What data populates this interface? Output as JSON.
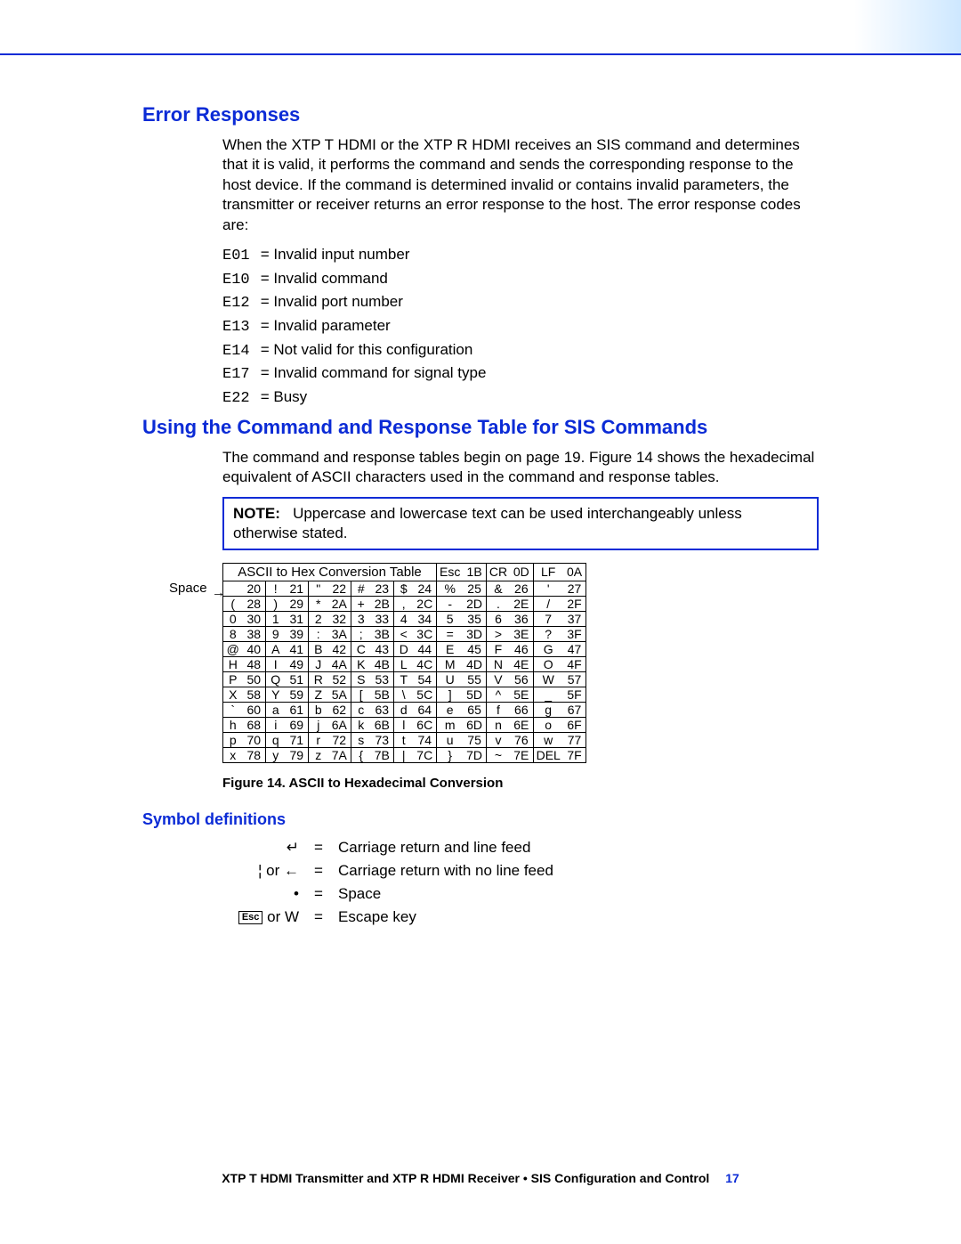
{
  "headings": {
    "error_responses": "Error Responses",
    "using_table": "Using the Command and Response Table for SIS Commands",
    "symbol_defs": "Symbol definitions"
  },
  "paragraphs": {
    "error_intro": "When the XTP T HDMI or the XTP R HDMI receives an SIS command and determines that it is valid, it performs the command and sends the corresponding response to the host device. If the command is determined invalid or contains invalid parameters, the transmitter or receiver returns an error response to the host. The error response codes are:",
    "using_intro": "The command and response tables begin on page 19. Figure 14 shows the hexadecimal equivalent of ASCII characters used in the command and response tables."
  },
  "error_codes": [
    {
      "code": "E01",
      "desc": "Invalid input number"
    },
    {
      "code": "E10",
      "desc": "Invalid command"
    },
    {
      "code": "E12",
      "desc": "Invalid port number"
    },
    {
      "code": "E13",
      "desc": "Invalid parameter"
    },
    {
      "code": "E14",
      "desc": "Not valid for this configuration"
    },
    {
      "code": "E17",
      "desc": "Invalid command for signal type"
    },
    {
      "code": "E22",
      "desc": "Busy"
    }
  ],
  "note": {
    "label": "NOTE:",
    "text": "Uppercase and lowercase text can be used interchangeably unless otherwise stated."
  },
  "ascii_table": {
    "title": "ASCII to Hex Conversion Table",
    "header_extra": [
      {
        "ch": "Esc",
        "hx": "1B"
      },
      {
        "ch": "CR",
        "hx": "0D"
      },
      {
        "ch": "LF",
        "hx": "0A"
      }
    ],
    "space_label": "Space",
    "rows": [
      [
        [
          "",
          "20"
        ],
        [
          "!",
          "21"
        ],
        [
          "\"",
          "22"
        ],
        [
          "#",
          "23"
        ],
        [
          "$",
          "24"
        ],
        [
          "%",
          "25"
        ],
        [
          "&",
          "26"
        ],
        [
          "'",
          "27"
        ]
      ],
      [
        [
          "(",
          "28"
        ],
        [
          ")",
          "29"
        ],
        [
          "*",
          "2A"
        ],
        [
          "+",
          "2B"
        ],
        [
          ",",
          "2C"
        ],
        [
          "-",
          "2D"
        ],
        [
          ".",
          "2E"
        ],
        [
          "/",
          "2F"
        ]
      ],
      [
        [
          "0",
          "30"
        ],
        [
          "1",
          "31"
        ],
        [
          "2",
          "32"
        ],
        [
          "3",
          "33"
        ],
        [
          "4",
          "34"
        ],
        [
          "5",
          "35"
        ],
        [
          "6",
          "36"
        ],
        [
          "7",
          "37"
        ]
      ],
      [
        [
          "8",
          "38"
        ],
        [
          "9",
          "39"
        ],
        [
          ":",
          "3A"
        ],
        [
          ";",
          "3B"
        ],
        [
          "<",
          "3C"
        ],
        [
          "=",
          "3D"
        ],
        [
          ">",
          "3E"
        ],
        [
          "?",
          "3F"
        ]
      ],
      [
        [
          "@",
          "40"
        ],
        [
          "A",
          "41"
        ],
        [
          "B",
          "42"
        ],
        [
          "C",
          "43"
        ],
        [
          "D",
          "44"
        ],
        [
          "E",
          "45"
        ],
        [
          "F",
          "46"
        ],
        [
          "G",
          "47"
        ]
      ],
      [
        [
          "H",
          "48"
        ],
        [
          "I",
          "49"
        ],
        [
          "J",
          "4A"
        ],
        [
          "K",
          "4B"
        ],
        [
          "L",
          "4C"
        ],
        [
          "M",
          "4D"
        ],
        [
          "N",
          "4E"
        ],
        [
          "O",
          "4F"
        ]
      ],
      [
        [
          "P",
          "50"
        ],
        [
          "Q",
          "51"
        ],
        [
          "R",
          "52"
        ],
        [
          "S",
          "53"
        ],
        [
          "T",
          "54"
        ],
        [
          "U",
          "55"
        ],
        [
          "V",
          "56"
        ],
        [
          "W",
          "57"
        ]
      ],
      [
        [
          "X",
          "58"
        ],
        [
          "Y",
          "59"
        ],
        [
          "Z",
          "5A"
        ],
        [
          "[",
          "5B"
        ],
        [
          "\\",
          "5C"
        ],
        [
          "]",
          "5D"
        ],
        [
          "^",
          "5E"
        ],
        [
          "_",
          "5F"
        ]
      ],
      [
        [
          "`",
          "60"
        ],
        [
          "a",
          "61"
        ],
        [
          "b",
          "62"
        ],
        [
          "c",
          "63"
        ],
        [
          "d",
          "64"
        ],
        [
          "e",
          "65"
        ],
        [
          "f",
          "66"
        ],
        [
          "g",
          "67"
        ]
      ],
      [
        [
          "h",
          "68"
        ],
        [
          "i",
          "69"
        ],
        [
          "j",
          "6A"
        ],
        [
          "k",
          "6B"
        ],
        [
          "l",
          "6C"
        ],
        [
          "m",
          "6D"
        ],
        [
          "n",
          "6E"
        ],
        [
          "o",
          "6F"
        ]
      ],
      [
        [
          "p",
          "70"
        ],
        [
          "q",
          "71"
        ],
        [
          "r",
          "72"
        ],
        [
          "s",
          "73"
        ],
        [
          "t",
          "74"
        ],
        [
          "u",
          "75"
        ],
        [
          "v",
          "76"
        ],
        [
          "w",
          "77"
        ]
      ],
      [
        [
          "x",
          "78"
        ],
        [
          "y",
          "79"
        ],
        [
          "z",
          "7A"
        ],
        [
          "{",
          "7B"
        ],
        [
          "|",
          "7C"
        ],
        [
          "}",
          "7D"
        ],
        [
          "~",
          "7E"
        ],
        [
          "DEL",
          "7F"
        ]
      ]
    ]
  },
  "figure_caption": "Figure 14.  ASCII to Hexadecimal Conversion",
  "symbols": [
    {
      "sym": "↵",
      "desc": "Carriage return and line feed"
    },
    {
      "sym": "¦ or ←",
      "desc": "Carriage return with no line feed"
    },
    {
      "sym": "•",
      "desc": "Space"
    },
    {
      "sym": "[Esc] or W",
      "desc": "Escape key"
    }
  ],
  "footer": {
    "text": "XTP T HDMI Transmitter and XTP R HDMI Receiver • SIS Configuration and Control",
    "page": "17"
  }
}
